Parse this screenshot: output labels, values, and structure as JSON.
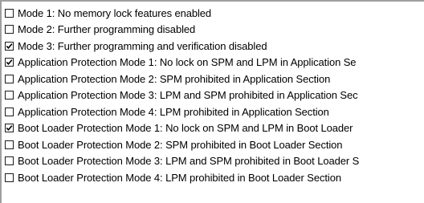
{
  "options": [
    {
      "label": "Mode 1: No memory lock features enabled",
      "checked": false
    },
    {
      "label": "Mode 2: Further programming disabled",
      "checked": false
    },
    {
      "label": "Mode 3: Further programming and verification disabled",
      "checked": true
    },
    {
      "label": "Application Protection Mode 1: No lock on SPM and LPM in Application Se",
      "checked": true
    },
    {
      "label": "Application Protection Mode 2: SPM prohibited in Application Section",
      "checked": false
    },
    {
      "label": "Application Protection Mode 3: LPM and SPM prohibited in Application Sec",
      "checked": false
    },
    {
      "label": "Application Protection Mode 4: LPM prohibited in Application Section",
      "checked": false
    },
    {
      "label": "Boot Loader Protection Mode 1: No lock on SPM and LPM in Boot Loader",
      "checked": true
    },
    {
      "label": "Boot Loader Protection Mode 2: SPM prohibited in Boot Loader Section",
      "checked": false
    },
    {
      "label": "Boot Loader Protection Mode 3: LPM and SPM prohibited in Boot Loader S",
      "checked": false
    },
    {
      "label": "Boot Loader Protection Mode 4: LPM prohibited in Boot Loader Section",
      "checked": false
    }
  ],
  "icons": {
    "check": "checkmark-icon"
  }
}
